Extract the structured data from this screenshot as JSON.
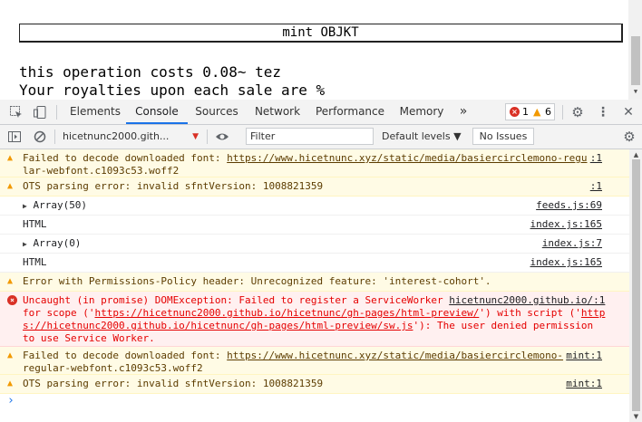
{
  "page": {
    "mint_button": "mint OBJKT",
    "cost_line": "this operation costs 0.08~ tez",
    "royalties_line": "Your royalties upon each sale are %"
  },
  "devtools": {
    "tabs": [
      "Elements",
      "Console",
      "Sources",
      "Network",
      "Performance",
      "Memory"
    ],
    "active_tab": "Console",
    "more_tabs": "»",
    "errors_count": "1",
    "warnings_count": "6",
    "context": "hicetnunc2000.gith...",
    "filter_placeholder": "Filter",
    "levels": "Default levels ▼",
    "no_issues": "No Issues"
  },
  "console": [
    {
      "type": "warn",
      "line1": "Failed to decode downloaded font: ",
      "link1": "https://www.hicetnunc.xyz/static/media/basiercirclemono-regu",
      "line2": "lar-webfont.c1093c53.woff2",
      "src": ":1"
    },
    {
      "type": "warn",
      "text": "OTS parsing error: invalid sfntVersion: 1008821359",
      "src": ":1"
    },
    {
      "type": "info",
      "expand": "▶",
      "text": "Array(50)",
      "src": "feeds.js:69"
    },
    {
      "type": "info",
      "text": "HTML",
      "src": "index.js:165"
    },
    {
      "type": "info",
      "expand": "▶",
      "text": "Array(0)",
      "src": "index.js:7"
    },
    {
      "type": "info",
      "text": "HTML",
      "src": "index.js:165"
    },
    {
      "type": "warn",
      "text": "Error with Permissions-Policy header: Unrecognized feature: 'interest-cohort'."
    },
    {
      "type": "error",
      "l1a": "Uncaught (in promise) DOMException: Failed to register a ServiceWorker ",
      "l1b": "hicetnunc2000.github.io/:1",
      "l2a": "for scope ('",
      "l2b": "https://hicetnunc2000.github.io/hicetnunc/gh-pages/html-preview/",
      "l2c": "') with script ('",
      "l2d": "http",
      "l3a": "s://hicetnunc2000.github.io/hicetnunc/gh-pages/html-preview/sw.js",
      "l3b": "'): The user denied permission",
      "l4": "to use Service Worker."
    },
    {
      "type": "warn",
      "line1": "Failed to decode downloaded font: ",
      "link1": "https://www.hicetnunc.xyz/static/media/basiercirclemono-",
      "line2": "regular-webfont.c1093c53.woff2",
      "src": "mint:1"
    },
    {
      "type": "warn",
      "text": "OTS parsing error: invalid sfntVersion: 1008821359",
      "src": "mint:1"
    }
  ],
  "prompt": "›"
}
